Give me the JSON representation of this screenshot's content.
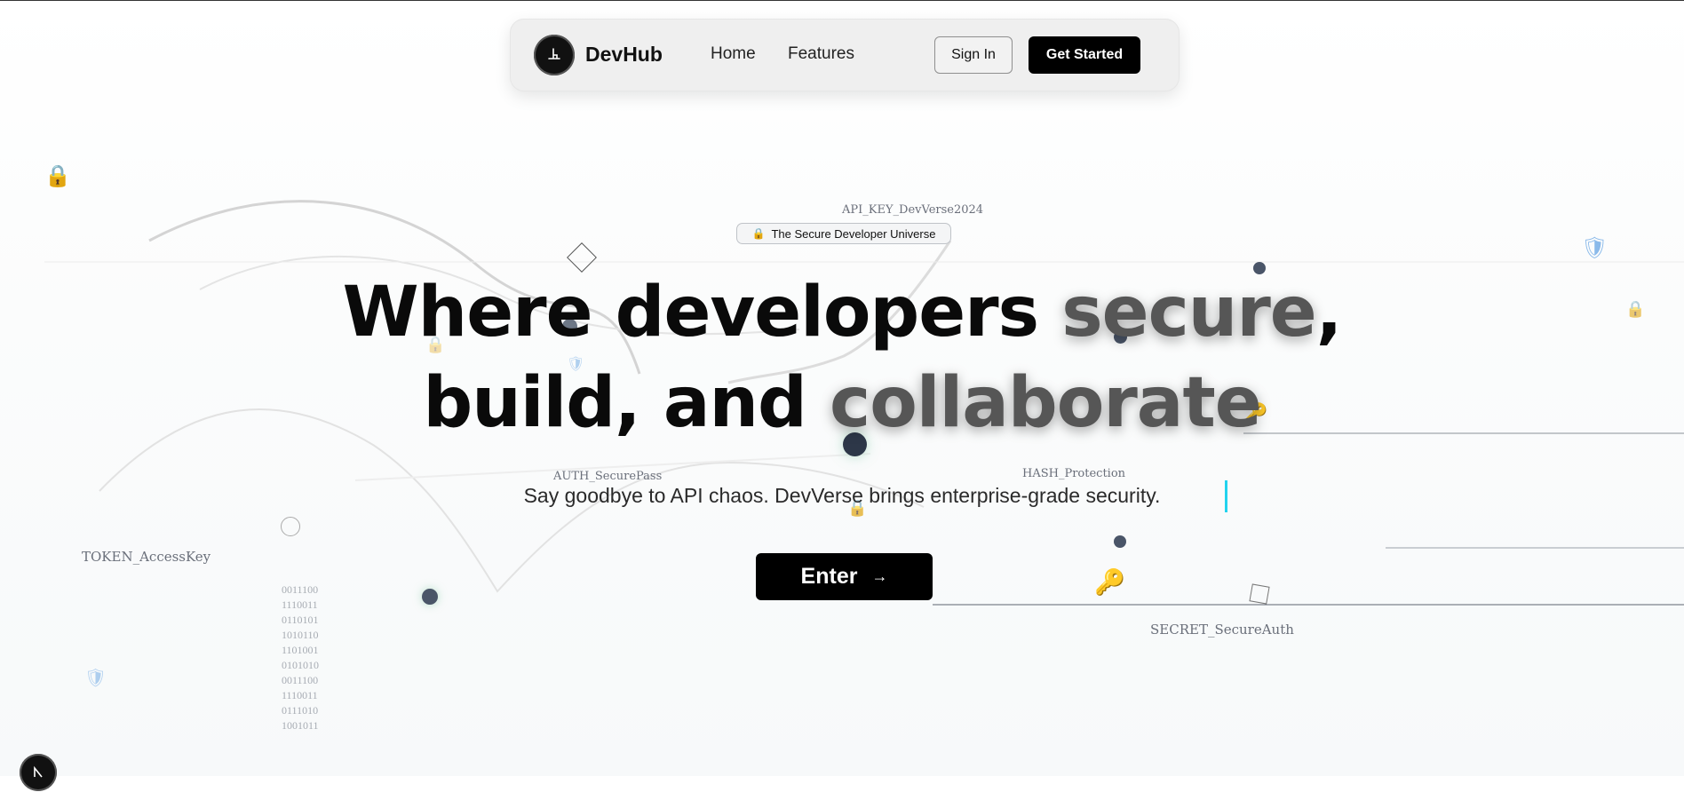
{
  "nav": {
    "brand": "DevHub",
    "links": [
      "Home",
      "Features"
    ],
    "sign_in": "Sign In",
    "get_started": "Get Started"
  },
  "hero": {
    "badge_icon": "🔒",
    "badge_text": "The Secure Developer Universe",
    "headline_line1_plain": "Where developers ",
    "headline_line1_accent": "secure",
    "headline_line1_end": ",",
    "headline_line2_plain": "build, and ",
    "headline_line2_accent": "collaborate",
    "subtitle": "Say goodbye to API chaos. DevVerse brings enterprise-grade security.",
    "enter_label": "Enter",
    "enter_arrow": "→"
  },
  "floating_labels": {
    "api_key": "API_KEY_DevVerse2024",
    "auth": "AUTH_SecurePass",
    "hash": "HASH_Protection",
    "token": "TOKEN_AccessKey",
    "secret": "SECRET_SecureAuth"
  },
  "binary_lines": [
    "0011100",
    "1110011",
    "0110101",
    "1010110",
    "1101001",
    "0101010",
    "0011100",
    "1110011",
    "0111010",
    "1001011"
  ],
  "icons": {
    "lock": "🔒",
    "key": "🔑",
    "shield": "🛡"
  },
  "colors": {
    "accent_text": "#565656",
    "cursor": "#22d3ee",
    "dot": "#4a5568"
  }
}
